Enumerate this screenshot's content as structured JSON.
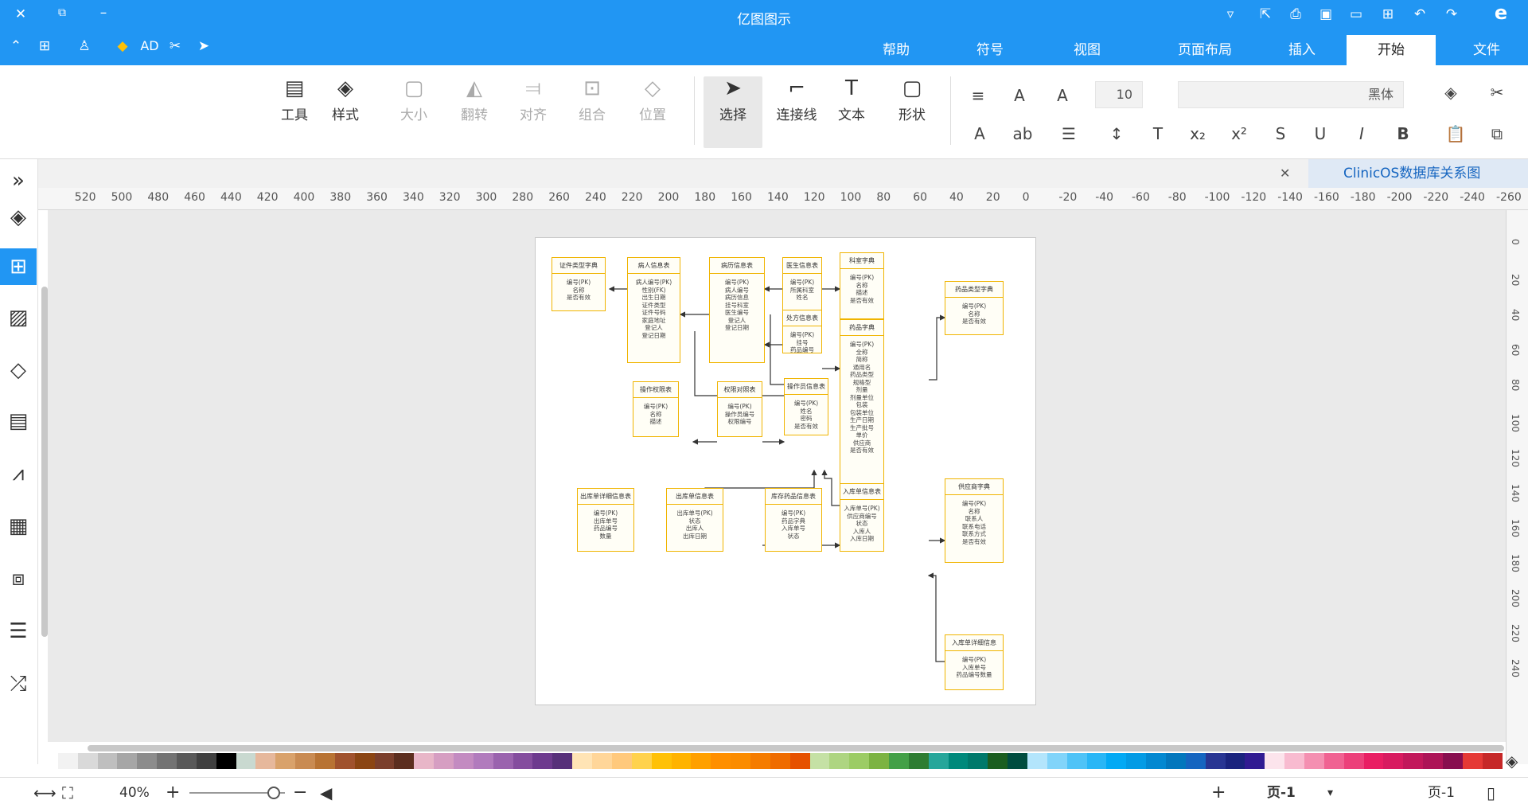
{
  "app": {
    "title": "亿图图示"
  },
  "quick_icons": [
    "close-icon",
    "restore-icon",
    "minimize-icon",
    "help-icon",
    "share-icon",
    "print-icon",
    "save-icon",
    "open-icon",
    "new-icon",
    "undo-icon",
    "redo-icon",
    "logo-icon"
  ],
  "menu_tabs": [
    {
      "label": "文件",
      "active": false
    },
    {
      "label": "开始",
      "active": true
    },
    {
      "label": "插入",
      "active": false
    },
    {
      "label": "页面布局",
      "active": false
    },
    {
      "label": "视图",
      "active": false
    },
    {
      "label": "符号",
      "active": false
    },
    {
      "label": "帮助",
      "active": false
    }
  ],
  "left_quick": {
    "ad_label": "AD"
  },
  "ribbon": {
    "tools": [
      {
        "label": "工具",
        "icon": "tool-icon",
        "enabled": true
      },
      {
        "label": "样式",
        "icon": "fill-bucket-icon",
        "enabled": true
      },
      {
        "label": "大小",
        "icon": "size-icon",
        "enabled": false
      },
      {
        "label": "翻转",
        "icon": "flip-icon",
        "enabled": false
      },
      {
        "label": "对齐",
        "icon": "align-icon",
        "enabled": false
      },
      {
        "label": "组合",
        "icon": "group-icon",
        "enabled": false
      },
      {
        "label": "位置",
        "icon": "layers-icon",
        "enabled": false
      },
      {
        "label": "选择",
        "icon": "select-arrow-icon",
        "enabled": true
      },
      {
        "label": "连接线",
        "icon": "connector-icon",
        "enabled": true
      },
      {
        "label": "文本",
        "icon": "text-icon",
        "enabled": true
      },
      {
        "label": "形状",
        "icon": "shape-icon",
        "enabled": true
      }
    ],
    "font_name": "黑体",
    "font_size": "10",
    "format_glyphs": {
      "bold": "B",
      "italic": "I",
      "underline": "U",
      "strike": "S",
      "sup": "x²",
      "sub": "x₂",
      "clear": "T",
      "grow": "A",
      "shrink": "A",
      "case": "ab",
      "color": "A"
    }
  },
  "document": {
    "tab_title": "ClinicOS数据库关系图"
  },
  "ruler": {
    "top": [
      "-260",
      "-240",
      "-220",
      "-200",
      "-180",
      "-160",
      "-140",
      "-120",
      "-100",
      "-80",
      "-60",
      "-40",
      "-20",
      "0",
      "20",
      "40",
      "60",
      "80",
      "100",
      "120",
      "140",
      "160",
      "180",
      "200",
      "220",
      "240",
      "260",
      "280",
      "300",
      "320",
      "340",
      "360",
      "380",
      "400",
      "420",
      "440",
      "460",
      "480",
      "500",
      "520"
    ],
    "left": [
      "0",
      "20",
      "40",
      "60",
      "80",
      "100",
      "120",
      "140",
      "160",
      "180",
      "200",
      "220",
      "240"
    ]
  },
  "left_tools": [
    "format-icon",
    "library-icon",
    "image-icon",
    "layers-icon",
    "page-icon",
    "chart-icon",
    "table-icon",
    "structure-icon",
    "outline-icon",
    "shuffle-icon"
  ],
  "diagram": {
    "tables": [
      {
        "id": "t1",
        "name": "证件类型字典",
        "fields": [
          "编号(PK)",
          "名称",
          "是否有效"
        ]
      },
      {
        "id": "t2",
        "name": "病人信息表",
        "fields": [
          "病人编号(PK)",
          "性别(FK)",
          "出生日期",
          "证件类型",
          "证件号码",
          "家庭地址",
          "登记人",
          "登记日期"
        ]
      },
      {
        "id": "t3",
        "name": "病历信息表",
        "fields": [
          "编号(PK)",
          "病人编号",
          "病历信息",
          "挂号科室",
          "医生编号",
          "登记人",
          "登记日期"
        ]
      },
      {
        "id": "t4",
        "name": "医生信息表",
        "fields": [
          "编号(PK)",
          "所属科室",
          "姓名"
        ]
      },
      {
        "id": "t5",
        "name": "科室字典",
        "fields": [
          "编号(PK)",
          "名称",
          "描述",
          "是否有效"
        ]
      },
      {
        "id": "t6",
        "name": "药品类型字典",
        "fields": [
          "编号(PK)",
          "名称",
          "是否有效"
        ]
      },
      {
        "id": "t7",
        "name": "处方信息表",
        "fields": [
          "编号(PK)",
          "挂号",
          "药品编号"
        ]
      },
      {
        "id": "t8",
        "name": "药品字典",
        "fields": [
          "编号(PK)",
          "全称",
          "简称",
          "通用名",
          "药品类型",
          "规格型",
          "剂量",
          "剂量单位",
          "包装",
          "包装单位",
          "生产日期",
          "生产批号",
          "单价",
          "供应商",
          "是否有效"
        ]
      },
      {
        "id": "t9",
        "name": "操作权限表",
        "fields": [
          "编号(PK)",
          "名称",
          "描述"
        ]
      },
      {
        "id": "t10",
        "name": "权限对照表",
        "fields": [
          "编号(PK)",
          "操作员编号",
          "权限编号"
        ]
      },
      {
        "id": "t11",
        "name": "操作员信息表",
        "fields": [
          "编号(PK)",
          "姓名",
          "密码",
          "是否有效"
        ]
      },
      {
        "id": "t12",
        "name": "出库单详细信息表",
        "fields": [
          "编号(PK)",
          "出库单号",
          "药品编号",
          "数量"
        ]
      },
      {
        "id": "t13",
        "name": "出库单信息表",
        "fields": [
          "出库单号(PK)",
          "状态",
          "出库人",
          "出库日期"
        ]
      },
      {
        "id": "t14",
        "name": "库存药品信息表",
        "fields": [
          "编号(PK)",
          "药品字典",
          "入库单号",
          "状态"
        ]
      },
      {
        "id": "t15",
        "name": "入库单信息表",
        "fields": [
          "入库单号(PK)",
          "供应商编号",
          "状态",
          "入库人",
          "入库日期"
        ]
      },
      {
        "id": "t16",
        "name": "供应商字典",
        "fields": [
          "编号(PK)",
          "名称",
          "联系人",
          "联系电话",
          "联系方式",
          "是否有效"
        ]
      },
      {
        "id": "t17",
        "name": "入库单详细信息",
        "fields": [
          "编号(PK)",
          "入库单号",
          "药品编号数量"
        ]
      }
    ]
  },
  "palette": [
    "#ffffff",
    "#f2f2f2",
    "#d9d9d9",
    "#bfbfbf",
    "#a6a6a6",
    "#8c8c8c",
    "#737373",
    "#595959",
    "#404040",
    "#000000",
    "#c9d9d0",
    "#e6b89c",
    "#d9a26b",
    "#c98b52",
    "#b87333",
    "#a0522d",
    "#8b4513",
    "#7b3f2c",
    "#5c2e1f",
    "#e8b6c8",
    "#d69ec2",
    "#c38bc1",
    "#b17bbd",
    "#9a63ae",
    "#844d9e",
    "#6d3a8e",
    "#57307a",
    "#ffe4b5",
    "#ffd699",
    "#ffc97c",
    "#ffd24d",
    "#ffc107",
    "#ffb300",
    "#ffa000",
    "#ff8f00",
    "#fb8c00",
    "#f57c00",
    "#ef6c00",
    "#e65100",
    "#c5e1a5",
    "#aed581",
    "#9ccc65",
    "#7cb342",
    "#43a047",
    "#2e7d32",
    "#26a69a",
    "#00897b",
    "#00796b",
    "#1b5e20",
    "#004d40",
    "#b3e5fc",
    "#81d4fa",
    "#4fc3f7",
    "#29b6f6",
    "#03a9f4",
    "#039be5",
    "#0288d1",
    "#0277bd",
    "#1565c0",
    "#283593",
    "#1a237e",
    "#311b92",
    "#fce4ec",
    "#f8bbd0",
    "#f48fb1",
    "#f06292",
    "#ec407a",
    "#e91e63",
    "#d81b60",
    "#c2185b",
    "#ad1457",
    "#880e4f",
    "#e53935",
    "#c62828"
  ],
  "status": {
    "page_label": "页-1",
    "page_tab": "页-1",
    "zoom": "40%"
  }
}
